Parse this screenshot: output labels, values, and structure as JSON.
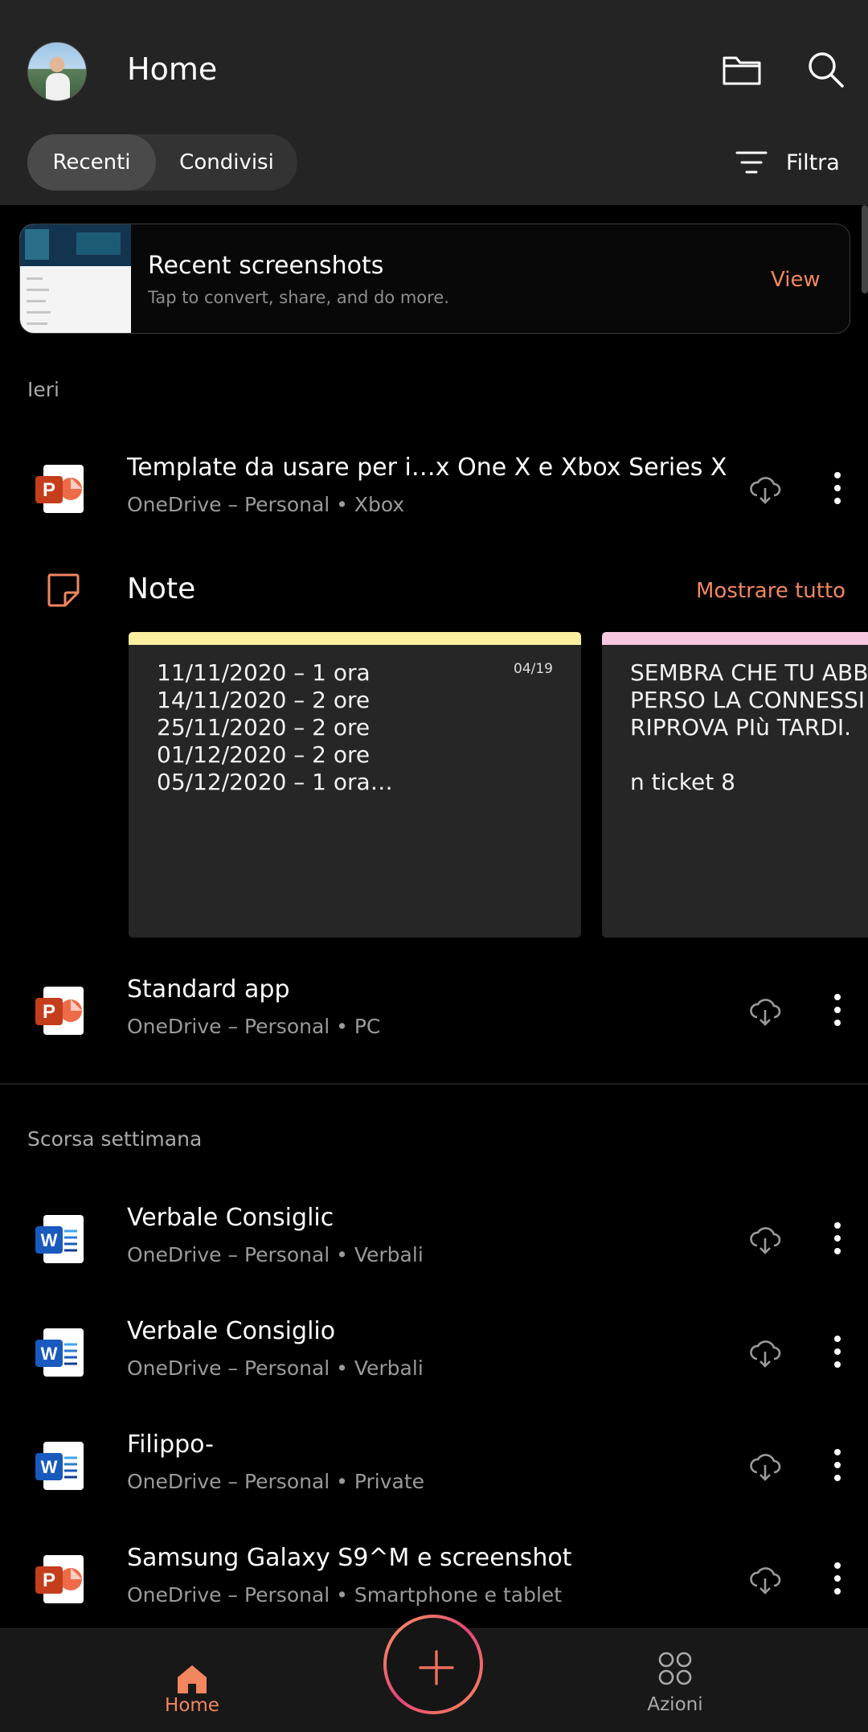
{
  "header": {
    "title": "Home",
    "tabs": [
      {
        "label": "Recenti",
        "active": true
      },
      {
        "label": "Condivisi",
        "active": false
      }
    ],
    "filter_label": "Filtra",
    "icons": [
      "folder-icon",
      "search-icon"
    ]
  },
  "banner": {
    "title": "Recent screenshots",
    "subtitle": "Tap to convert, share, and do more.",
    "action": "View"
  },
  "sections": {
    "yesterday": "Ieri",
    "last_week": "Scorsa settimana"
  },
  "files": [
    {
      "title": "Template da usare per i…x One X e Xbox Series X",
      "subtitle": "OneDrive – Personal • Xbox",
      "type": "powerpoint"
    },
    {
      "title": "Standard app",
      "subtitle": "OneDrive – Personal • PC",
      "type": "powerpoint"
    },
    {
      "title": "Verbale Consiglic",
      "subtitle": "OneDrive – Personal • Verbali",
      "type": "word"
    },
    {
      "title": "Verbale Consiglio",
      "subtitle": "OneDrive – Personal • Verbali",
      "type": "word"
    },
    {
      "title": "Filippo-",
      "subtitle": "OneDrive – Personal • Private",
      "type": "word"
    },
    {
      "title": "Samsung Galaxy S9^M e screenshot",
      "subtitle": "OneDrive – Personal • Smartphone e tablet",
      "type": "powerpoint"
    }
  ],
  "notes": {
    "title": "Note",
    "show_all": "Mostrare tutto",
    "cards": [
      {
        "color": "#faeea1",
        "date": "04/19",
        "text": "11/11/2020 – 1 ora\n14/11/2020 – 2 ore\n25/11/2020 – 2 ore\n01/12/2020 – 2 ore\n05/12/2020 – 1 ora…"
      },
      {
        "color": "#f8c8e0",
        "text": "SEMBRA CHE TU ABB\nPERSO LA CONNESSI\nRIPROVA PIù TARDI.\n\nn ticket 8"
      }
    ]
  },
  "bottom_nav": {
    "home": "Home",
    "actions": "Azioni"
  },
  "colors": {
    "accent": "#f2865e",
    "powerpoint": "#c43e1c",
    "word": "#185abd"
  }
}
